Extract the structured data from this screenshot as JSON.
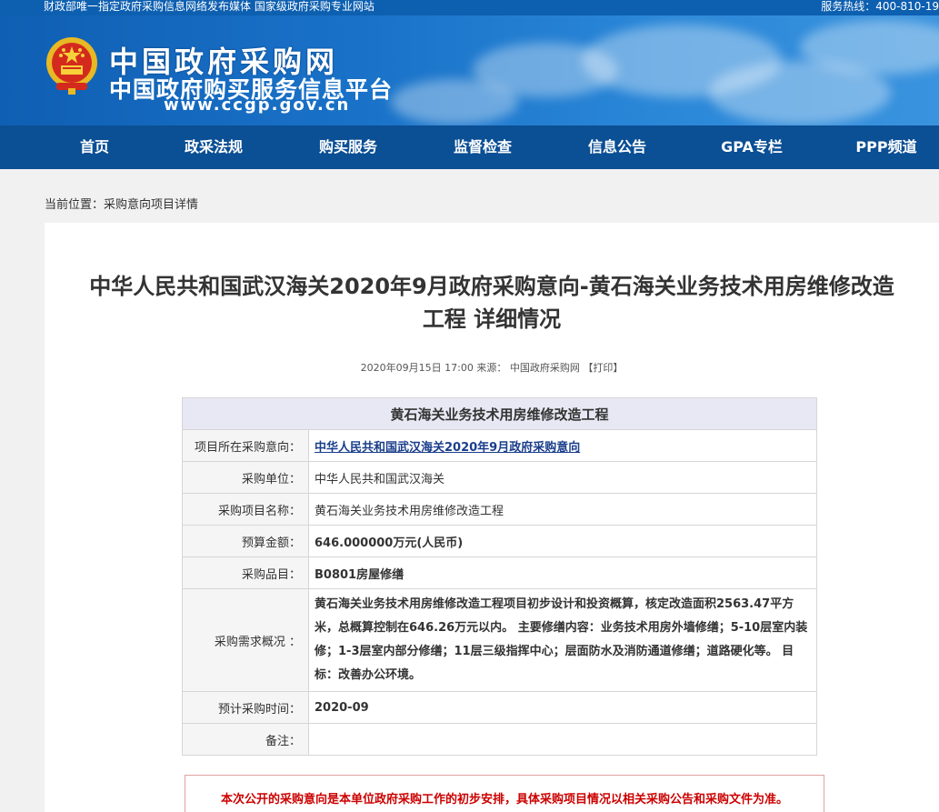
{
  "topbar": {
    "left_text": "财政部唯一指定政府采购信息网络发布媒体 国家级政府采购专业网站",
    "hotline": "服务热线：400-810-19"
  },
  "banner": {
    "title_line1": "中国政府采购网",
    "title_line2": "中国政府购买服务信息平台",
    "url": "www.ccgp.gov.cn",
    "emblem_icon": "national-emblem-icon"
  },
  "nav": {
    "items": [
      {
        "label": "首页"
      },
      {
        "label": "政采法规"
      },
      {
        "label": "购买服务"
      },
      {
        "label": "监督检查"
      },
      {
        "label": "信息公告"
      },
      {
        "label": "GPA专栏"
      },
      {
        "label": "PPP频道"
      }
    ]
  },
  "breadcrumb": "当前位置：采购意向项目详情",
  "article": {
    "title_line1": "中华人民共和国武汉海关2020年9月政府采购意向-黄石海关业务技术用房维修改造",
    "title_line2": "工程 详细情况",
    "date": "2020年09月15日 17:00",
    "source_label": "来源：",
    "source": "中国政府采购网",
    "print": "【打印】"
  },
  "detail": {
    "heading": "黄石海关业务技术用房维修改造工程",
    "rows": [
      {
        "label": "项目所在采购意向：",
        "value": "中华人民共和国武汉海关2020年9月政府采购意向"
      },
      {
        "label": "采购单位：",
        "value": "中华人民共和国武汉海关"
      },
      {
        "label": "采购项目名称：",
        "value": "黄石海关业务技术用房维修改造工程"
      },
      {
        "label": "预算金额：",
        "value": "646.000000万元(人民币)"
      },
      {
        "label": "采购品目：",
        "value": "B0801房屋修缮"
      },
      {
        "label": "采购需求概况 ：",
        "value": "黄石海关业务技术用房维修改造工程项目初步设计和投资概算，核定改造面积2563.47平方米，总概算控制在646.26万元以内。 主要修缮内容：业务技术用房外墙修缮；5-10层室内装修；1-3层室内部分修缮；11层三级指挥中心；层面防水及消防通道修缮；道路硬化等。 目标：改善办公环境。"
      },
      {
        "label": "预计采购时间：",
        "value": "2020-09"
      },
      {
        "label": "备注：",
        "value": ""
      }
    ]
  },
  "notice": "本次公开的采购意向是本单位政府采购工作的初步安排，具体采购项目情况以相关采购公告和采购文件为准。"
}
